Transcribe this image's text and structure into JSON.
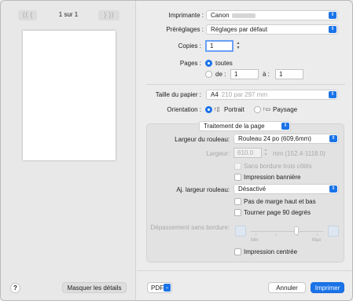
{
  "nav": {
    "prev_glyphs": "⟨⟨   ⟨",
    "next_glyphs": "⟩   ⟩⟩",
    "page_indicator": "1 sur 1"
  },
  "preview_pane": {
    "help_glyph": "?",
    "hide_details_label": "Masquer les détails"
  },
  "printer": {
    "label": "Imprimante :",
    "value": "Canon"
  },
  "presets": {
    "label": "Préréglages :",
    "value": "Réglages par défaut"
  },
  "copies": {
    "label": "Copies :",
    "value": "1"
  },
  "pages": {
    "label": "Pages :",
    "all_label": "toutes",
    "range_from_label": "de :",
    "from_value": "1",
    "to_label": "à :",
    "to_value": "1"
  },
  "paper_size": {
    "label": "Taille du papier :",
    "value": "A4",
    "dimensions": "210 par 297 mm"
  },
  "orientation": {
    "label": "Orientation :",
    "portrait_label": "Portrait",
    "landscape_label": "Paysage",
    "selected": "portrait"
  },
  "section": {
    "value": "Traitement de la page"
  },
  "roll_width": {
    "label": "Largeur du rouleau:",
    "value": "Rouleau 24 po (609,6mm)"
  },
  "width": {
    "label": "Largeur:",
    "value": "610.0",
    "unit_range": "mm (152.4-1118.0)"
  },
  "options_1": {
    "borderless_three_sides": "Sans bordure trois côtés",
    "banner_printing": "Impression bannière"
  },
  "adjust_roll_width": {
    "label": "Aj. largeur rouleau:",
    "value": "Désactivé"
  },
  "options_2": {
    "no_top_bottom_margin": "Pas de marge haut et bas",
    "rotate_90": "Tourner page 90 degrés"
  },
  "borderless_overflow": {
    "label": "Dépassement sans bordure:",
    "min_label": "Min",
    "max_label": "Max"
  },
  "options_3": {
    "centered_printing": "Impression centrée"
  },
  "footer": {
    "pdf_label": "PDF",
    "cancel_label": "Annuler",
    "print_label": "Imprimer"
  },
  "colors": {
    "accent": "#1a73e8",
    "window_bg": "#ececec",
    "panel_bg": "#e2e2e2"
  }
}
